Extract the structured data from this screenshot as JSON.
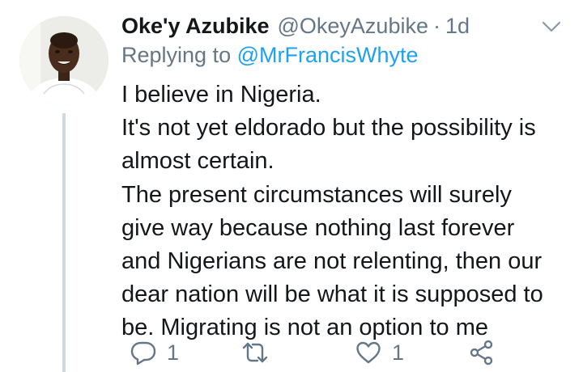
{
  "tweet": {
    "author_name": "Oke'y Azubike",
    "handle": "@OkeyAzubike",
    "separator": "·",
    "time": "1d",
    "replying_prefix": "Replying to",
    "replying_to": "@MrFrancisWhyte",
    "text_lines": [
      "I believe in Nigeria.",
      "It's not yet eldorado but the possibility is",
      "almost certain.",
      "The present circumstances will surely",
      "give way because nothing last forever",
      "and Nigerians are not relenting, then our",
      "dear nation will be what it is supposed to",
      "be. Migrating is not an option to me"
    ],
    "actions": {
      "reply_count": "1",
      "retweet_count": "",
      "like_count": "1"
    }
  },
  "colors": {
    "text": "#14171a",
    "secondary": "#657786",
    "link": "#1da1f2",
    "thread_line": "#cfd9de"
  },
  "icons": {
    "menu": "chevron-down-icon",
    "reply": "speech-bubble-icon",
    "retweet": "retweet-icon",
    "like": "heart-icon",
    "share": "share-icon"
  }
}
